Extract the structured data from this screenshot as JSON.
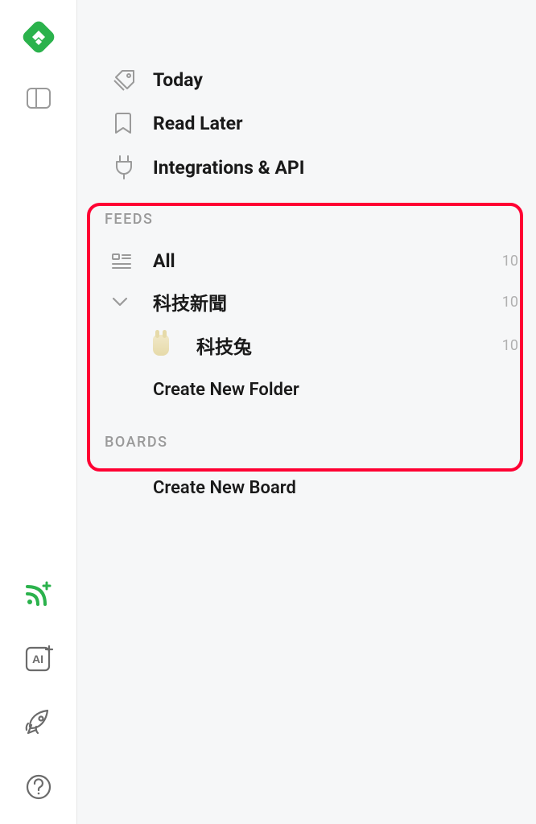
{
  "topnav": {
    "today": "Today",
    "read_later": "Read Later",
    "integrations": "Integrations & API"
  },
  "feeds": {
    "header": "FEEDS",
    "all": {
      "label": "All",
      "count": "10"
    },
    "folders": [
      {
        "label": "科技新聞",
        "count": "10",
        "items": [
          {
            "label": "科技兔",
            "count": "10"
          }
        ]
      }
    ],
    "create_folder": "Create New Folder"
  },
  "boards": {
    "header": "BOARDS",
    "create_board": "Create New Board"
  }
}
